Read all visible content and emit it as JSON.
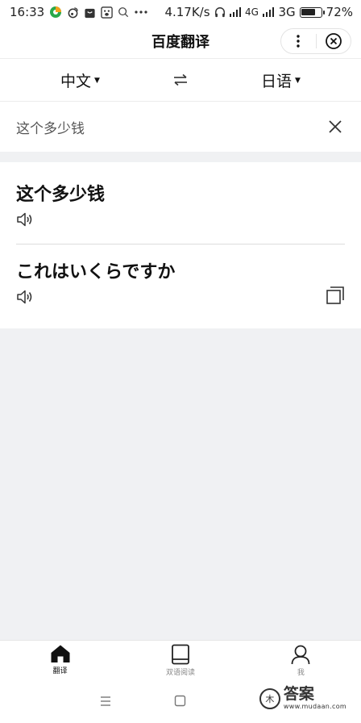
{
  "status_bar": {
    "time": "16:33",
    "net_speed": "4.17K/s",
    "network_1": "4G",
    "network_2": "3G",
    "battery": "72%",
    "battery_level": 0.72
  },
  "header": {
    "title": "百度翻译"
  },
  "language_bar": {
    "source_lang": "中文",
    "target_lang": "日语"
  },
  "input": {
    "text": "这个多少钱"
  },
  "result": {
    "source_text": "这个多少钱",
    "translated_text": "これはいくらですか"
  },
  "tabs": [
    {
      "label": "翻译",
      "active": true
    },
    {
      "label": "双语阅读",
      "active": false
    },
    {
      "label": "我",
      "active": false
    }
  ],
  "watermark": {
    "logo_text": "答案",
    "url": "www.mudaan.com",
    "seal": "木"
  },
  "colors": {
    "background": "#f0f1f3",
    "surface": "#ffffff",
    "text": "#111111",
    "muted": "#888888"
  }
}
